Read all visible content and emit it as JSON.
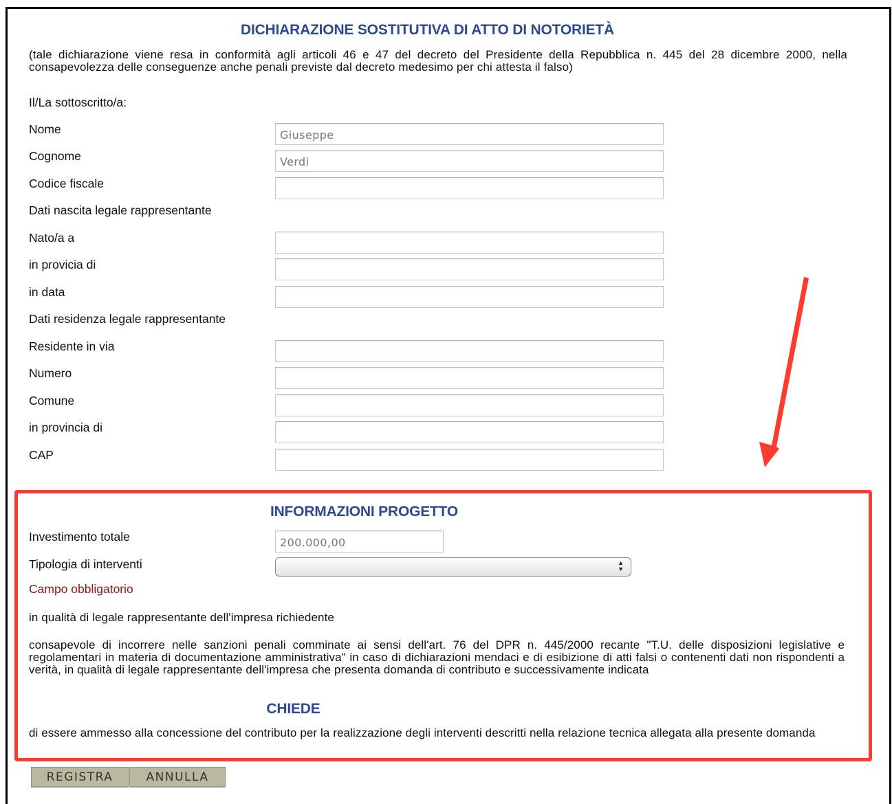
{
  "header": {
    "title": "DICHIARAZIONE SOSTITUTIVA DI ATTO DI NOTORIETÀ",
    "intro": "(tale dichiarazione viene resa in conformità agli articoli 46 e 47 del decreto del Presidente della Repubblica n. 445 del 28 dicembre 2000, nella consapevolezza delle conseguenze anche penali previste dal decreto medesimo per chi attesta il falso)"
  },
  "form": {
    "signer_label": "Il/La sottoscritto/a:",
    "nome_label": "Nome",
    "nome_value": "Giuseppe",
    "cognome_label": "Cognome",
    "cognome_value": "Verdi",
    "codice_fiscale_label": "Codice fiscale",
    "codice_fiscale_value": "",
    "nascita_section": "Dati nascita legale rappresentante",
    "nato_label": "Nato/a a",
    "nato_value": "",
    "provicia_nascita_label": "in provicia di",
    "provicia_nascita_value": "",
    "data_label": "in data",
    "data_value": "",
    "residenza_section": "Dati residenza legale rappresentante",
    "via_label": "Residente in via",
    "via_value": "",
    "numero_label": "Numero",
    "numero_value": "",
    "comune_label": "Comune",
    "comune_value": "",
    "provincia_res_label": "in provincia di",
    "provincia_res_value": "",
    "cap_label": "CAP",
    "cap_value": ""
  },
  "progetto": {
    "title": "INFORMAZIONI PROGETTO",
    "investimento_label": "Investimento totale",
    "investimento_value": "200.000,00",
    "tipologia_label": "Tipologia di interventi",
    "tipologia_selected": "",
    "required_msg": "Campo obbligatorio",
    "qualita_text": "in qualità di legale rappresentante dell'impresa richiedente",
    "consapevole_text": "consapevole di incorrere nelle sanzioni penali comminate ai sensi dell'art. 76 del DPR n. 445/2000 recante \"T.U. delle disposizioni legislative e regolamentari in materia di documentazione amministrativa\" in caso di dichiarazioni mendaci e di esibizione di atti falsi o contenenti dati non rispondenti a verità, in qualità di legale rappresentante dell'impresa che presenta domanda di contributo e successivamente indicata",
    "chiede_title": "CHIEDE",
    "chiede_text": "di essere ammesso alla concessione del contributo per la realizzazione degli interventi descritti nella relazione tecnica allegata alla presente domanda"
  },
  "buttons": {
    "registra": "REGISTRA",
    "annulla": "ANNULLA"
  },
  "colors": {
    "title_blue": "#2c4a8c",
    "highlight_red": "#ff3b30",
    "required_red": "#8b1a1a",
    "button_bg": "#b9b9a0"
  }
}
